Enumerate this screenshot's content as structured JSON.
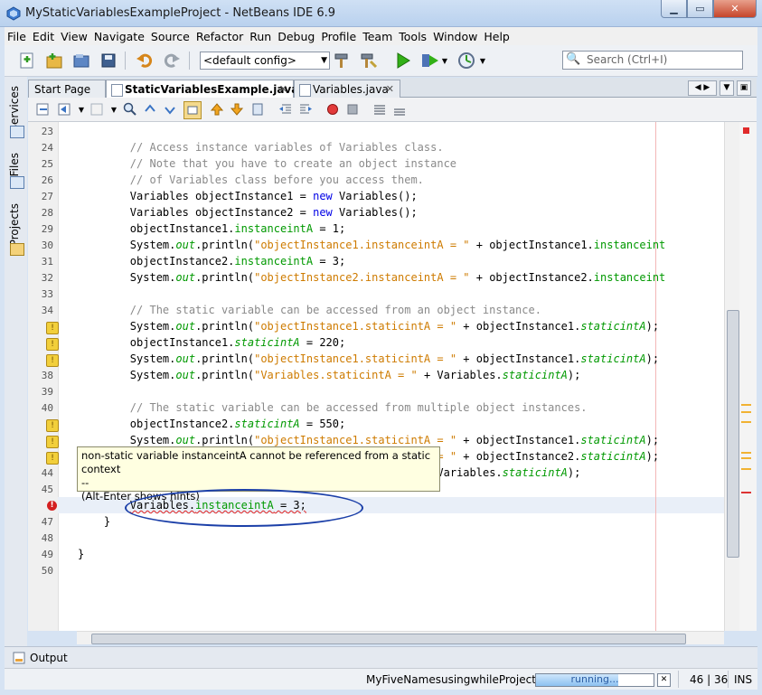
{
  "window": {
    "title": "MyStaticVariablesExampleProject - NetBeans IDE 6.9",
    "min_label": "▁",
    "max_label": "▭",
    "close_label": "✕"
  },
  "menu": [
    "File",
    "Edit",
    "View",
    "Navigate",
    "Source",
    "Refactor",
    "Run",
    "Debug",
    "Profile",
    "Team",
    "Tools",
    "Window",
    "Help"
  ],
  "toolbar": {
    "config": "<default config>",
    "search_placeholder": "Search (Ctrl+I)"
  },
  "side_tabs": [
    "Services",
    "Files",
    "Projects"
  ],
  "tabs": [
    {
      "label": "Start Page"
    },
    {
      "label": "StaticVariablesExample.java",
      "active": true
    },
    {
      "label": "Variables.java"
    }
  ],
  "editor": {
    "lines": [
      {
        "n": "23",
        "html": ""
      },
      {
        "n": "24",
        "html": "<span class='cmt'>        // Access instance variables of Variables class.</span>"
      },
      {
        "n": "25",
        "html": "<span class='cmt'>        // Note that you have to create an object instance</span>"
      },
      {
        "n": "26",
        "html": "<span class='cmt'>        // of Variables class before you access them.</span>"
      },
      {
        "n": "27",
        "html": "        Variables objectInstance1 = <span class='kw'>new</span> Variables();"
      },
      {
        "n": "28",
        "html": "        Variables objectInstance2 = <span class='kw'>new</span> Variables();"
      },
      {
        "n": "29",
        "html": "        objectInstance1.<span class='fld'>instanceintA</span> = 1;"
      },
      {
        "n": "30",
        "html": "        System.<span class='sfld'>out</span>.println(<span class='str'>\"objectInstance1.instanceintA = \"</span> + objectInstance1.<span class='fld'>instanceint</span>"
      },
      {
        "n": "31",
        "html": "        objectInstance2.<span class='fld'>instanceintA</span> = 3;"
      },
      {
        "n": "32",
        "html": "        System.<span class='sfld'>out</span>.println(<span class='str'>\"objectInstance2.instanceintA = \"</span> + objectInstance2.<span class='fld'>instanceint</span>"
      },
      {
        "n": "33",
        "html": ""
      },
      {
        "n": "34",
        "html": "<span class='cmt'>        // The static variable can be accessed from an object instance.</span>"
      },
      {
        "n": "",
        "warn": true,
        "html": "        System.<span class='sfld'>out</span>.println(<span class='str'>\"objectInstance1.staticintA = \"</span> + objectInstance1.<span class='sfld'>staticintA</span>);"
      },
      {
        "n": "",
        "warn": true,
        "html": "        objectInstance1.<span class='sfld'>staticintA</span> = 220;"
      },
      {
        "n": "",
        "warn": true,
        "html": "        System.<span class='sfld'>out</span>.println(<span class='str'>\"objectInstance1.staticintA = \"</span> + objectInstance1.<span class='sfld'>staticintA</span>);"
      },
      {
        "n": "38",
        "html": "        System.<span class='sfld'>out</span>.println(<span class='str'>\"Variables.staticintA = \"</span> + Variables.<span class='sfld'>staticintA</span>);"
      },
      {
        "n": "39",
        "html": ""
      },
      {
        "n": "40",
        "html": "<span class='cmt'>        // The static variable can be accessed from multiple object instances.</span>"
      },
      {
        "n": "",
        "warn": true,
        "html": "        objectInstance2.<span class='sfld'>staticintA</span> = 550;"
      },
      {
        "n": "",
        "warn": true,
        "html": "        System.<span class='sfld'>out</span>.println(<span class='str'>\"objectInstance1.staticintA = \"</span> + objectInstance1.<span class='sfld'>staticintA</span>);"
      },
      {
        "n": "",
        "warn": true,
        "html": "        System.<span class='sfld'>out</span>.println(<span class='str'>\"objectInstance2.staticintA = \"</span> + objectInstance2.<span class='sfld'>staticintA</span>);"
      },
      {
        "n": "44",
        "html": "        System.<span class='sfld'>out</span>.println(<span class='str'>\"Variables.staticintA = \"</span> + Variables.<span class='sfld'>staticintA</span>);"
      },
      {
        "n": "45",
        "html": ""
      },
      {
        "n": "",
        "err": true,
        "html": "        <span class='squiggle'>Variables.<span class='fld'>instanceintA</span> = 3;</span>"
      },
      {
        "n": "47",
        "html": "    }"
      },
      {
        "n": "48",
        "html": ""
      },
      {
        "n": "49",
        "html": "}"
      },
      {
        "n": "50",
        "html": ""
      }
    ],
    "tooltip": {
      "line1": "non-static variable instanceintA cannot be referenced from a static context",
      "line2": "--",
      "line3": "(Alt-Enter shows hints)"
    }
  },
  "output_label": "Output",
  "status": {
    "project": "MyFiveNamesusingwhileProject (run)",
    "progress_text": "running...",
    "progress_fraction": 0.7,
    "position": "46 | 36",
    "mode": "INS"
  }
}
